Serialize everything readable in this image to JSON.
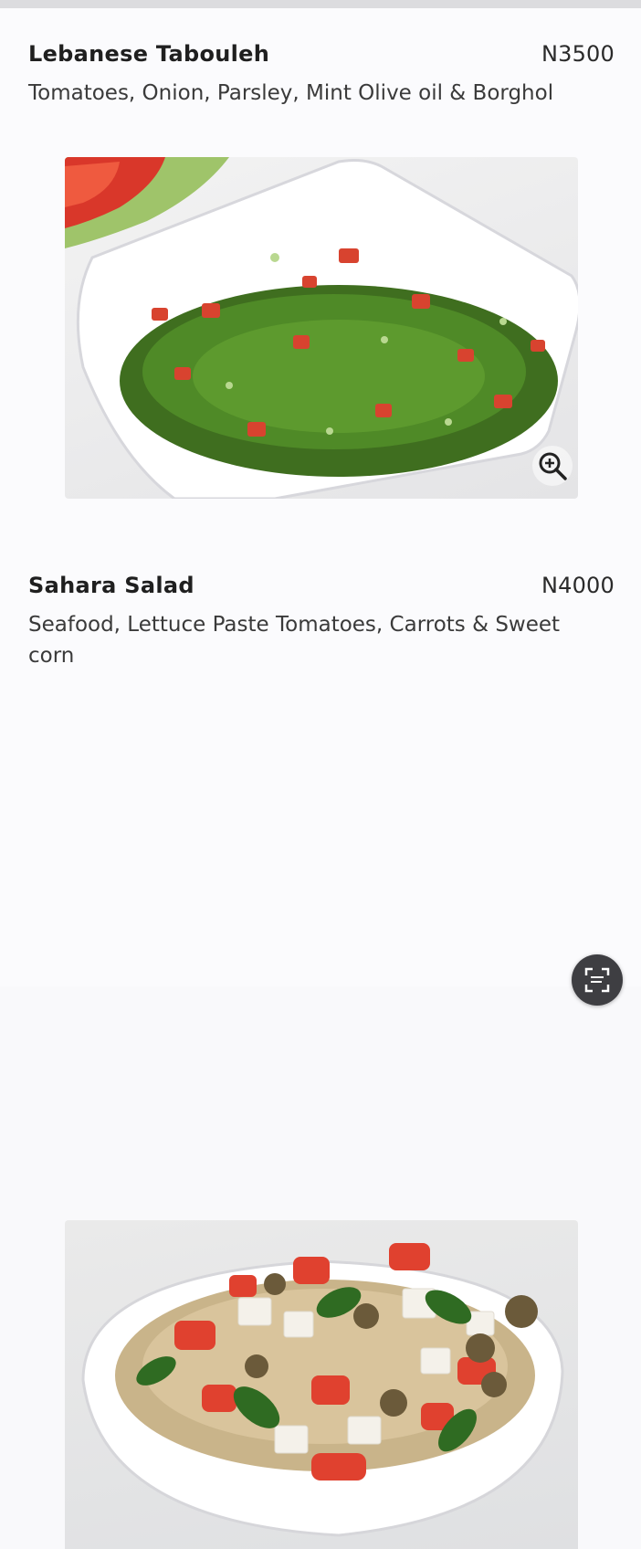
{
  "menu": {
    "items": [
      {
        "name": "Lebanese Tabouleh",
        "price": "N3500",
        "description": "Tomatoes, Onion, Parsley, Mint Olive oil & Borghol",
        "image_icon": "zoom-in-icon"
      },
      {
        "name": "Sahara Salad",
        "price": "N4000",
        "description": "Seafood, Lettuce Paste Tomatoes, Carrots & Sweet corn"
      }
    ]
  },
  "floating_action": {
    "icon": "scan-icon"
  },
  "colors": {
    "background": "#fbfbfd",
    "text": "#1f1f1f",
    "fab": "#3e3e42"
  }
}
